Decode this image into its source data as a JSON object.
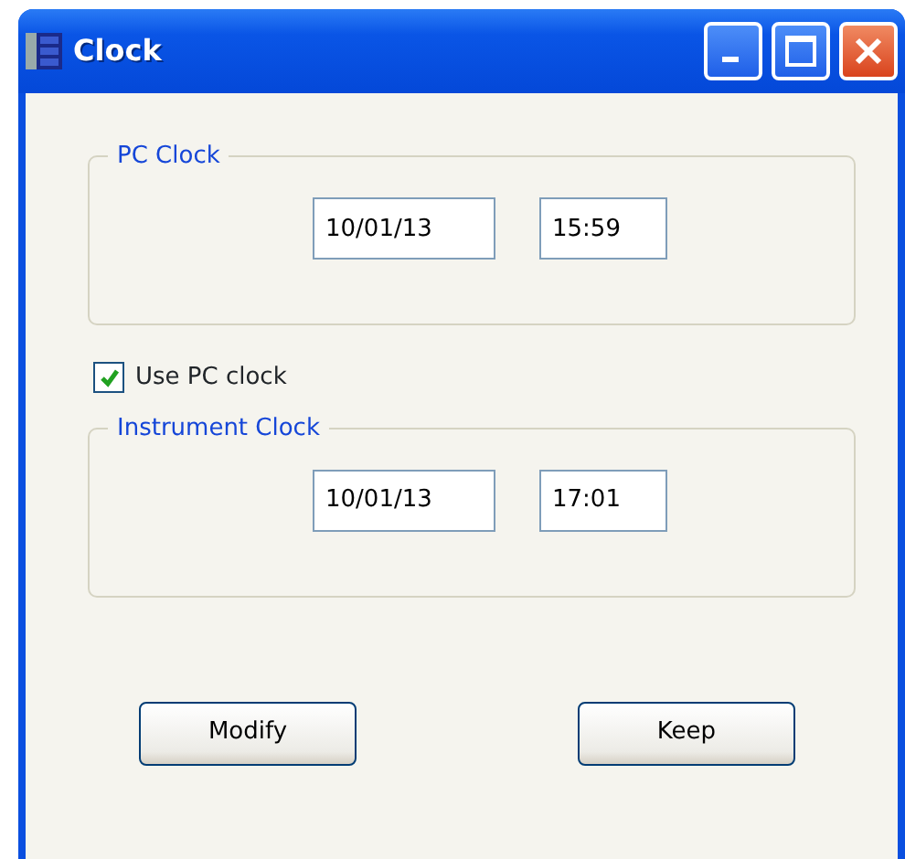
{
  "window": {
    "title": "Clock"
  },
  "groups": [
    {
      "title": "PC Clock",
      "date": "10/01/13",
      "time": "15:59"
    },
    {
      "title": "Instrument Clock",
      "date": "10/01/13",
      "time": "17:01"
    }
  ],
  "use_pc_clock": {
    "label": "Use PC clock",
    "checked": true
  },
  "buttons": [
    "Modify",
    "Keep"
  ]
}
